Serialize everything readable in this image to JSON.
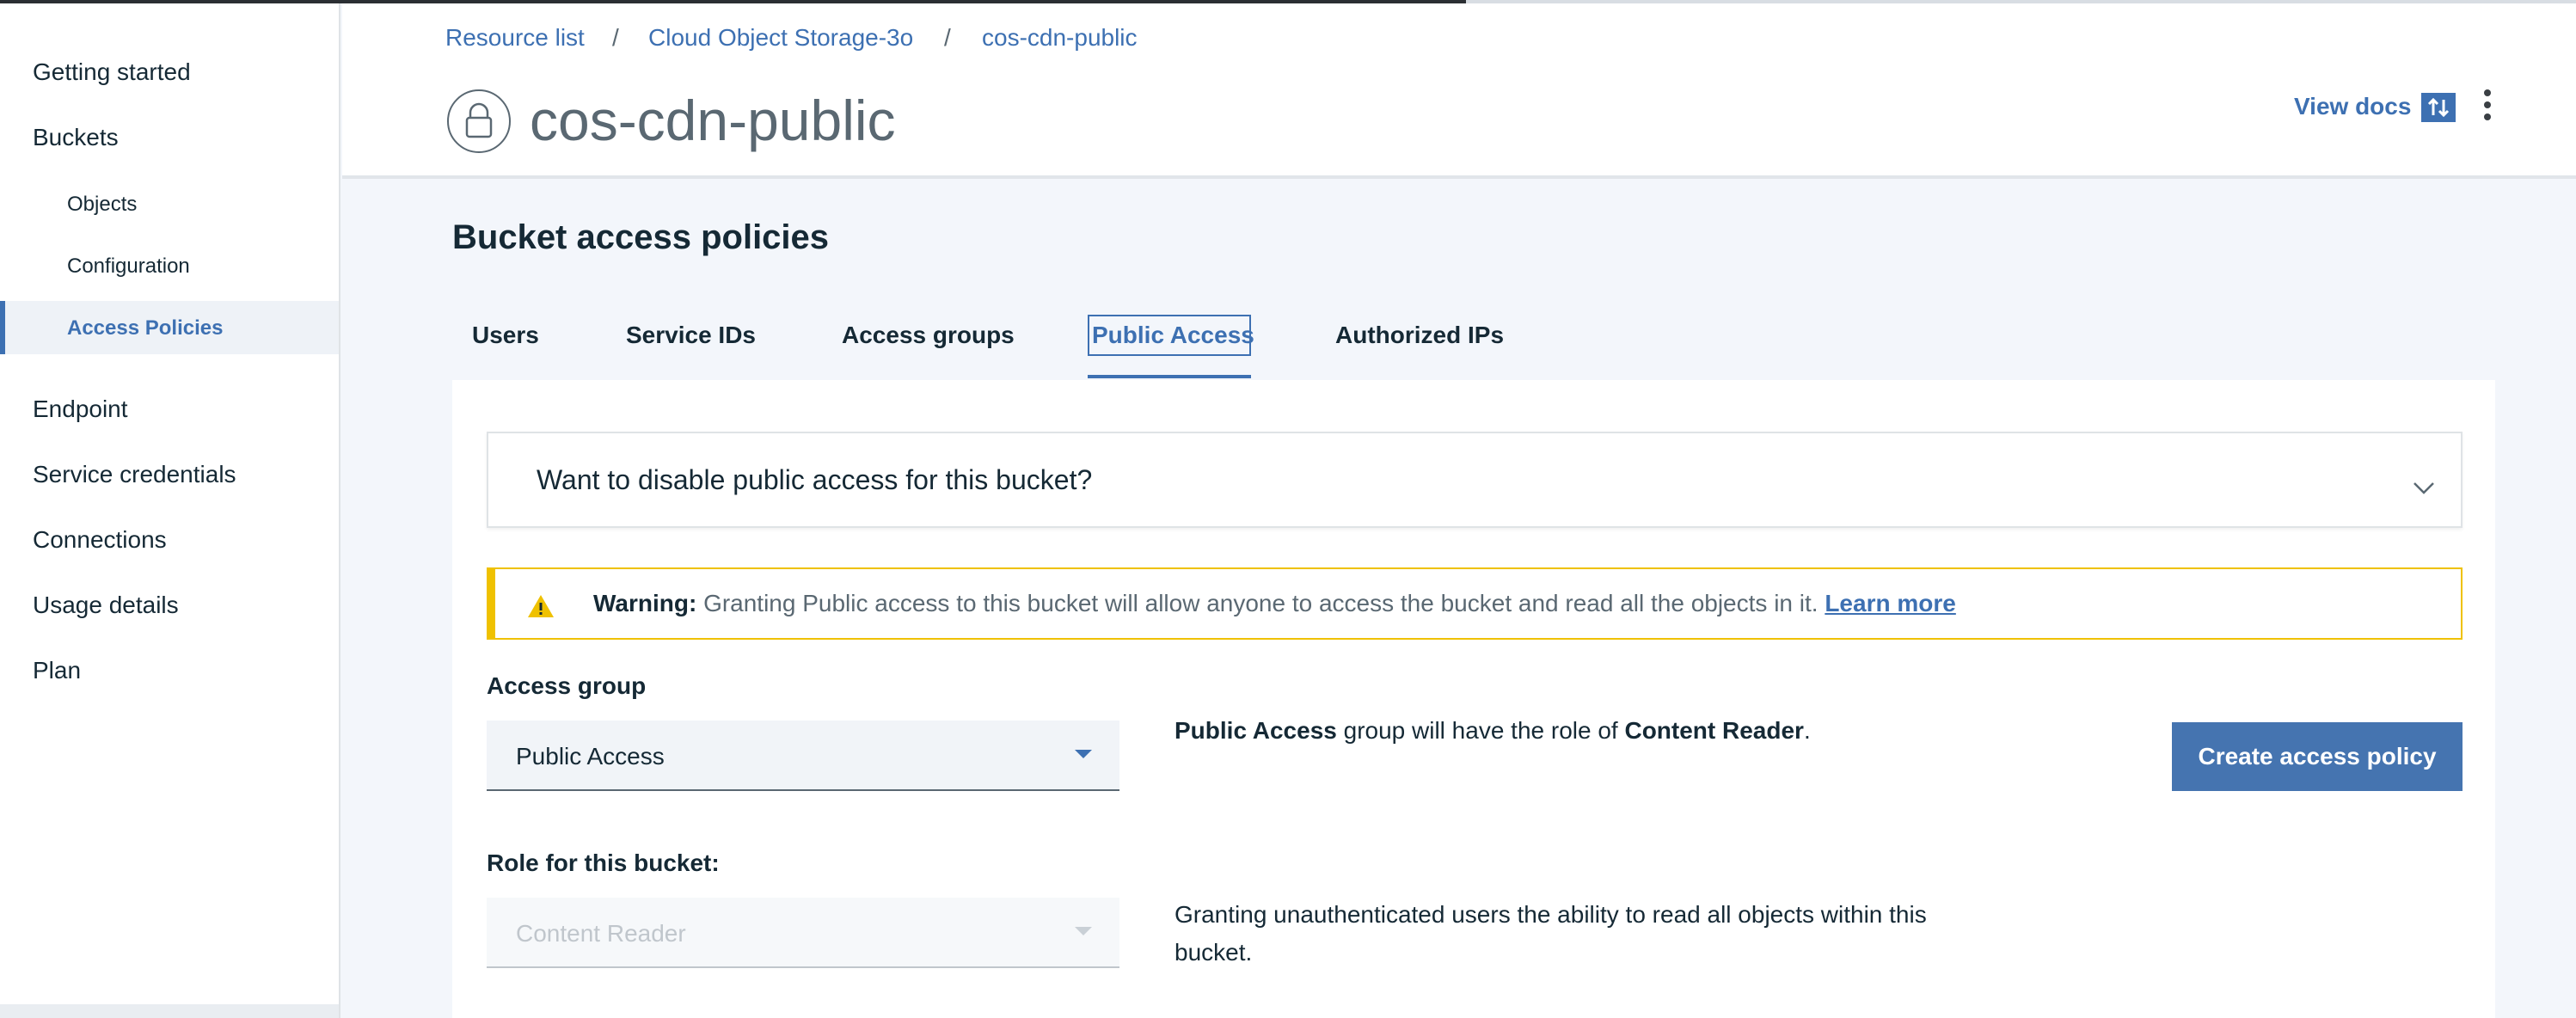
{
  "breadcrumb": {
    "items": [
      "Resource list",
      "Cloud Object Storage-3o",
      "cos-cdn-public"
    ],
    "separator": "/"
  },
  "header": {
    "title": "cos-cdn-public",
    "view_docs": "View docs",
    "icons": [
      "bucket-icon",
      "sort-icon",
      "overflow-menu-icon"
    ]
  },
  "sidebar": {
    "items": [
      {
        "label": "Getting started"
      },
      {
        "label": "Buckets"
      },
      {
        "label": "Objects"
      },
      {
        "label": "Configuration"
      },
      {
        "label": "Access Policies",
        "active": true
      },
      {
        "label": "Endpoint"
      },
      {
        "label": "Service credentials"
      },
      {
        "label": "Connections"
      },
      {
        "label": "Usage details"
      },
      {
        "label": "Plan"
      }
    ]
  },
  "section": {
    "title": "Bucket access policies",
    "tabs": [
      "Users",
      "Service IDs",
      "Access groups",
      "Public Access",
      "Authorized IPs"
    ],
    "active_tab": "Public Access"
  },
  "accordion": {
    "question": "Want to disable public access for this bucket?"
  },
  "warning": {
    "label": "Warning:",
    "text": "Granting Public access to this bucket will allow anyone to access the bucket and read all the objects in it.",
    "link": "Learn more"
  },
  "access_group": {
    "label": "Access group",
    "value": "Public Access",
    "desc_group": "Public Access",
    "desc_mid": "group will have the role of",
    "desc_role": "Content Reader",
    "desc_end": "."
  },
  "role": {
    "label": "Role for this bucket:",
    "value": "Content Reader",
    "description": "Granting unauthenticated users the ability to read all objects within this bucket."
  },
  "actions": {
    "create": "Create access policy"
  },
  "colors": {
    "accent": "#3d70b2",
    "warning": "#efc100",
    "primary_button": "#4574b0"
  }
}
